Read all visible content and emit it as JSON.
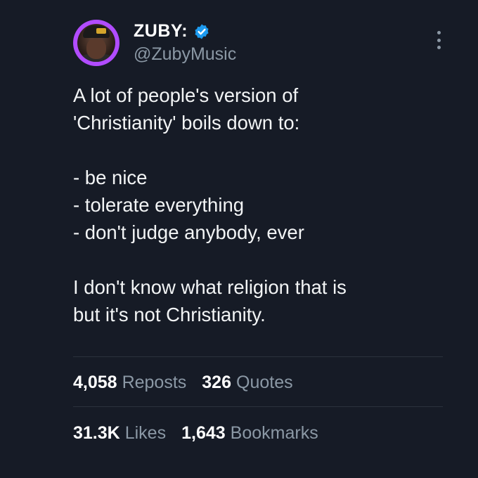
{
  "author": {
    "display_name": "ZUBY:",
    "handle": "@ZubyMusic",
    "verified": true,
    "avatar_ring_color": "#b14cff"
  },
  "icons": {
    "verified": "verified-badge-icon",
    "more": "more-vertical-icon"
  },
  "colors": {
    "background": "#161b26",
    "text_primary": "#ffffff",
    "text_secondary": "#8b98a5",
    "verified_blue": "#1d9bf0"
  },
  "tweet": {
    "lines": [
      "A lot of people's version of",
      "'Christianity' boils down to:",
      "",
      "- be nice",
      "- tolerate everything",
      "- don't judge anybody, ever",
      "",
      "I don't know what religion that is",
      "but it's not Christianity."
    ]
  },
  "stats": {
    "reposts": {
      "value": "4,058",
      "label": "Reposts"
    },
    "quotes": {
      "value": "326",
      "label": "Quotes"
    },
    "likes": {
      "value": "31.3K",
      "label": "Likes"
    },
    "bookmarks": {
      "value": "1,643",
      "label": "Bookmarks"
    }
  }
}
